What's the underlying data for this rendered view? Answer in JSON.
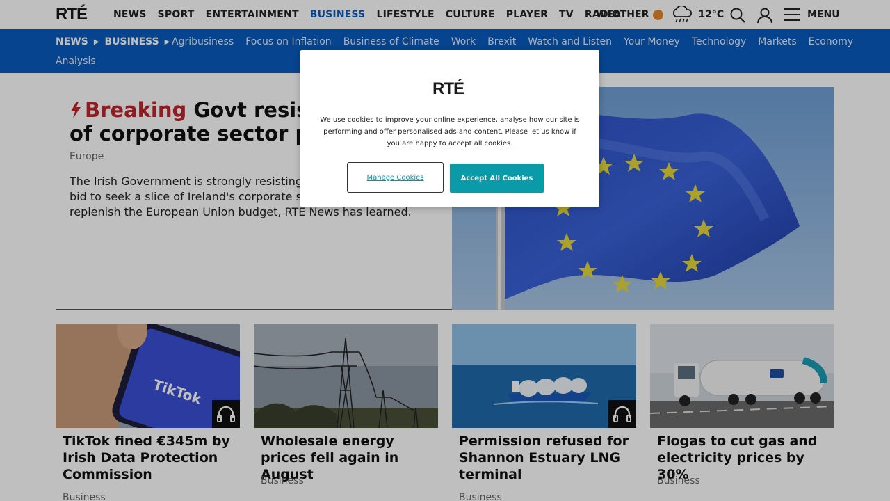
{
  "logo": "RTÉ",
  "nav": {
    "main": [
      "NEWS",
      "SPORT",
      "ENTERTAINMENT",
      "BUSINESS",
      "LIFESTYLE",
      "CULTURE",
      "PLAYER",
      "TV",
      "RADIO"
    ],
    "active": "BUSINESS",
    "weather_label": "WEATHER",
    "temperature": "12°C",
    "menu_label": "MENU"
  },
  "subnav": {
    "crumb_news": "NEWS",
    "crumb_business": "BUSINESS",
    "links": [
      "Agribusiness",
      "Focus on Inflation",
      "Business of Climate",
      "Work",
      "Brexit",
      "Watch and Listen",
      "Your Money",
      "Technology",
      "Markets",
      "Economy"
    ],
    "links_row2": [
      "Analysis"
    ]
  },
  "hero": {
    "breaking": "Breaking",
    "title": "Govt resisting EU bid to seek a slice of corporate sector profits",
    "title_visible_line1": "Govt resistin",
    "title_visible_line2": "of corporate sector prof",
    "section": "Europe",
    "description": "The Irish Government is strongly resisting a EU bid to seek a slice of Ireland's corporate sector replenish the European Union budget, RTÉ News has learned.",
    "desc_line1": "The Irish Government is strongly resisting a Eu",
    "desc_line2": "bid to seek a slice of Ireland's corporate secto",
    "desc_line3": "replenish the European Union budget, RTÉ News has learned."
  },
  "cards": [
    {
      "title": "TikTok fined €345m by Irish Data Protection Commission",
      "section": "Business",
      "audio": true
    },
    {
      "title": "Wholesale energy prices fell again in August",
      "section": "Business",
      "audio": false
    },
    {
      "title": "Permission refused for Shannon Estuary LNG terminal",
      "section": "Business",
      "audio": true
    },
    {
      "title": "Flogas to cut gas and electricity prices by 30%",
      "section": "Business",
      "audio": false
    }
  ],
  "cookie_modal": {
    "logo": "RTÉ",
    "text": "We use cookies to improve your online experience, analyse how our site is performing and offer personalised ads and content. Please let us know if you are happy to accept all cookies.",
    "manage_label": "Manage Cookies",
    "accept_label": "Accept All Cookies"
  },
  "colors": {
    "brand_blue": "#0a5bbf",
    "breaking_red": "#c0262d",
    "accept_teal": "#0a9aa8"
  }
}
